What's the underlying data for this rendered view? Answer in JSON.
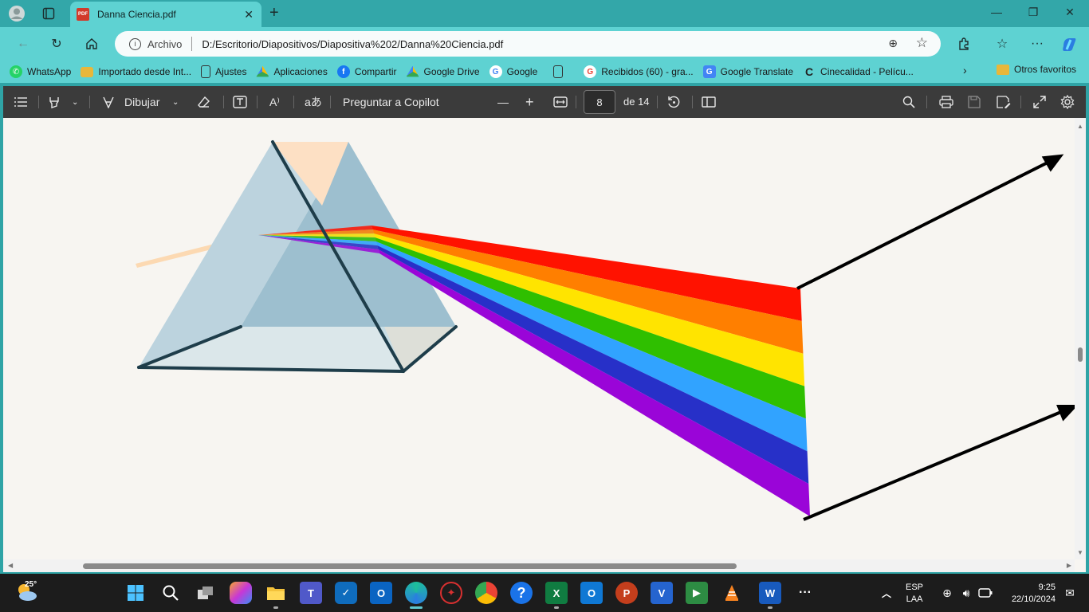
{
  "browser": {
    "tab_title": "Danna Ciencia.pdf",
    "tab_badge": "PDF",
    "address_scheme": "Archivo",
    "address_url": "D:/Escritorio/Diapositivos/Diapositiva%202/Danna%20Ciencia.pdf"
  },
  "bookmarks": [
    {
      "label": "WhatsApp",
      "icon": "whatsapp-icon",
      "color": "#25d366"
    },
    {
      "label": "Importado desde Int...",
      "icon": "folder-icon",
      "color": "#e8b73a"
    },
    {
      "label": "Ajustes",
      "icon": "page-icon",
      "color": "#ffffff"
    },
    {
      "label": "Aplicaciones",
      "icon": "drive-icon",
      "color": "#34a853"
    },
    {
      "label": "Compartir",
      "icon": "facebook-icon",
      "color": "#1877f2"
    },
    {
      "label": "Google Drive",
      "icon": "drive-icon",
      "color": "#34a853"
    },
    {
      "label": "Google",
      "icon": "google-icon",
      "color": "#4285f4"
    },
    {
      "label": "",
      "icon": "page-icon",
      "color": "#ffffff"
    },
    {
      "label": "Recibidos (60) - gra...",
      "icon": "google-icon",
      "color": "#ea4335"
    },
    {
      "label": "Google Translate",
      "icon": "translate-icon",
      "color": "#4285f4"
    },
    {
      "label": "Cinecalidad - Pelícu...",
      "icon": "cinecalidad-icon",
      "color": "#222222"
    }
  ],
  "bookmarks_other": "Otros favoritos",
  "pdf_toolbar": {
    "draw_label": "Dibujar",
    "copilot_label": "Preguntar a Copilot",
    "page_current": "8",
    "page_total": "de 14",
    "translate_glyph": "aあ",
    "readaloud_glyph": "A⁾"
  },
  "spectrum_colors": [
    "#ff1200",
    "#ff7f00",
    "#ffe400",
    "#2fbf00",
    "#31a3ff",
    "#2730c8",
    "#9a05d8"
  ],
  "taskbar": {
    "weather_temp": "25°",
    "lang_primary": "ESP",
    "lang_secondary": "LAA",
    "time": "9:25",
    "date": "22/10/2024"
  }
}
